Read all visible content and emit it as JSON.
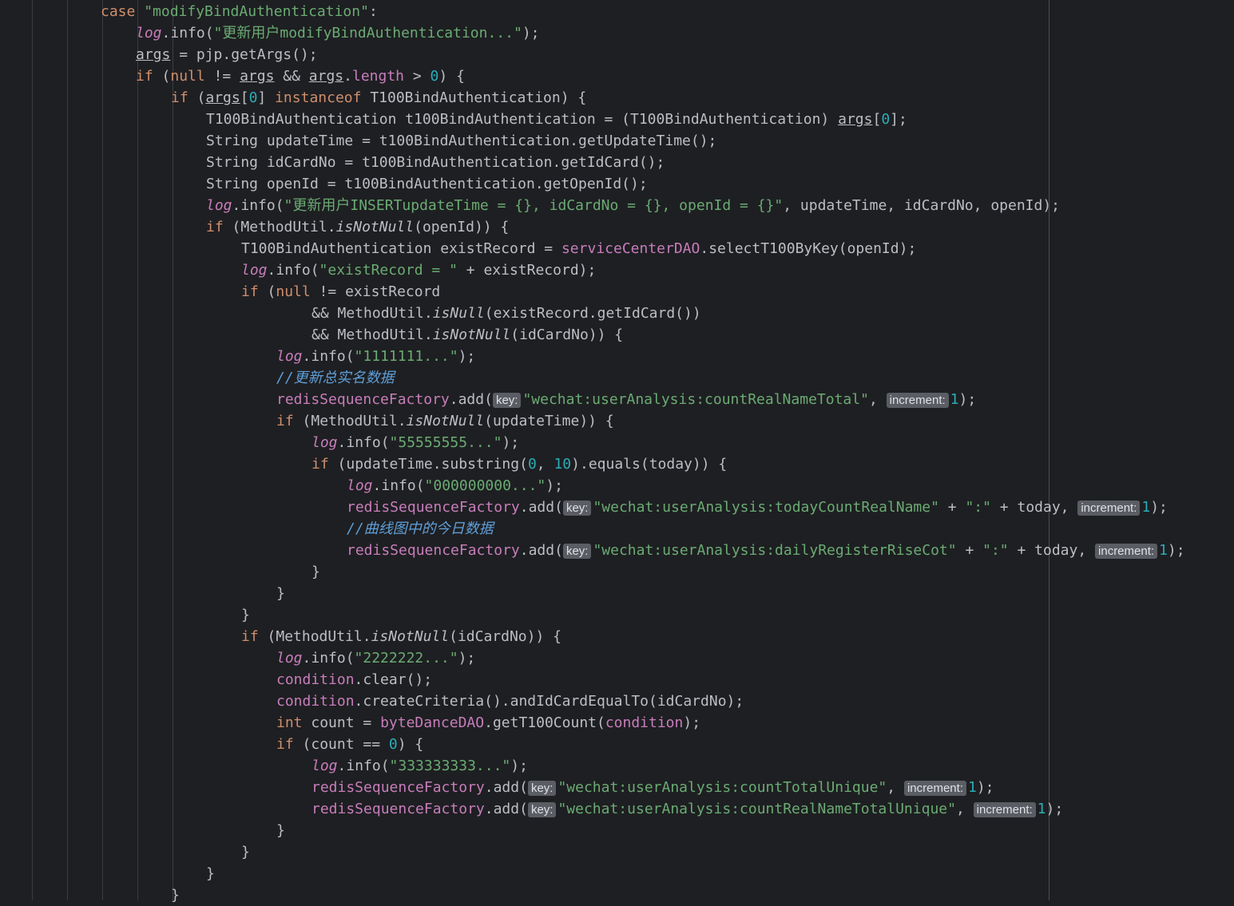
{
  "editor": {
    "lines": [
      {
        "indent": 126,
        "tokens": [
          {
            "t": "case ",
            "c": "kw"
          },
          {
            "t": "\"modifyBindAuthentication\"",
            "c": "str"
          },
          {
            "t": ":",
            "c": ""
          }
        ]
      },
      {
        "indent": 170,
        "tokens": [
          {
            "t": "log",
            "c": "log"
          },
          {
            "t": ".info(",
            "c": ""
          },
          {
            "t": "\"更新用户modifyBindAuthentication...\"",
            "c": "str"
          },
          {
            "t": ");",
            "c": ""
          }
        ]
      },
      {
        "indent": 170,
        "tokens": [
          {
            "t": "args",
            "c": "und"
          },
          {
            "t": " = pjp.getArgs();",
            "c": ""
          }
        ]
      },
      {
        "indent": 170,
        "tokens": [
          {
            "t": "if ",
            "c": "kw"
          },
          {
            "t": "(",
            "c": ""
          },
          {
            "t": "null",
            "c": "kw"
          },
          {
            "t": " != ",
            "c": ""
          },
          {
            "t": "args",
            "c": "und"
          },
          {
            "t": " && ",
            "c": ""
          },
          {
            "t": "args",
            "c": "und"
          },
          {
            "t": ".",
            "c": ""
          },
          {
            "t": "length",
            "c": "fld"
          },
          {
            "t": " > ",
            "c": ""
          },
          {
            "t": "0",
            "c": "num"
          },
          {
            "t": ") {",
            "c": ""
          }
        ]
      },
      {
        "indent": 214,
        "tokens": [
          {
            "t": "if ",
            "c": "kw"
          },
          {
            "t": "(",
            "c": ""
          },
          {
            "t": "args",
            "c": "und"
          },
          {
            "t": "[",
            "c": ""
          },
          {
            "t": "0",
            "c": "num"
          },
          {
            "t": "] ",
            "c": ""
          },
          {
            "t": "instanceof ",
            "c": "kw"
          },
          {
            "t": "T100BindAuthentication) {",
            "c": ""
          }
        ]
      },
      {
        "indent": 258,
        "tokens": [
          {
            "t": "T100BindAuthentication t100BindAuthentication = (T100BindAuthentication) ",
            "c": ""
          },
          {
            "t": "args",
            "c": "und"
          },
          {
            "t": "[",
            "c": ""
          },
          {
            "t": "0",
            "c": "num"
          },
          {
            "t": "];",
            "c": ""
          }
        ]
      },
      {
        "indent": 258,
        "tokens": [
          {
            "t": "String updateTime = t100BindAuthentication.getUpdateTime();",
            "c": ""
          }
        ]
      },
      {
        "indent": 258,
        "tokens": [
          {
            "t": "String idCardNo = t100BindAuthentication.getIdCard();",
            "c": ""
          }
        ]
      },
      {
        "indent": 258,
        "tokens": [
          {
            "t": "String openId = t100BindAuthentication.getOpenId();",
            "c": ""
          }
        ]
      },
      {
        "indent": 258,
        "tokens": [
          {
            "t": "log",
            "c": "log"
          },
          {
            "t": ".info(",
            "c": ""
          },
          {
            "t": "\"更新用户INSERTupdateTime = {}, idCardNo = {}, openId = {}\"",
            "c": "str"
          },
          {
            "t": ", updateTime, idCardNo, openId);",
            "c": ""
          }
        ]
      },
      {
        "indent": 258,
        "tokens": [
          {
            "t": "if ",
            "c": "kw"
          },
          {
            "t": "(MethodUtil.",
            "c": ""
          },
          {
            "t": "isNotNull",
            "c": "st"
          },
          {
            "t": "(openId)) {",
            "c": ""
          }
        ]
      },
      {
        "indent": 302,
        "tokens": [
          {
            "t": "T100BindAuthentication existRecord = ",
            "c": ""
          },
          {
            "t": "serviceCenterDAO",
            "c": "fld"
          },
          {
            "t": ".selectT100ByKey(openId);",
            "c": ""
          }
        ]
      },
      {
        "indent": 302,
        "tokens": [
          {
            "t": "log",
            "c": "log"
          },
          {
            "t": ".info(",
            "c": ""
          },
          {
            "t": "\"existRecord = \"",
            "c": "str"
          },
          {
            "t": " + existRecord);",
            "c": ""
          }
        ]
      },
      {
        "indent": 302,
        "tokens": [
          {
            "t": "if ",
            "c": "kw"
          },
          {
            "t": "(",
            "c": ""
          },
          {
            "t": "null",
            "c": "kw"
          },
          {
            "t": " != existRecord",
            "c": ""
          }
        ]
      },
      {
        "indent": 390,
        "tokens": [
          {
            "t": "&& MethodUtil.",
            "c": ""
          },
          {
            "t": "isNull",
            "c": "st"
          },
          {
            "t": "(existRecord.getIdCard())",
            "c": ""
          }
        ]
      },
      {
        "indent": 390,
        "tokens": [
          {
            "t": "&& MethodUtil.",
            "c": ""
          },
          {
            "t": "isNotNull",
            "c": "st"
          },
          {
            "t": "(idCardNo)) {",
            "c": ""
          }
        ]
      },
      {
        "indent": 346,
        "tokens": [
          {
            "t": "log",
            "c": "log"
          },
          {
            "t": ".info(",
            "c": ""
          },
          {
            "t": "\"1111111...\"",
            "c": "str"
          },
          {
            "t": ");",
            "c": ""
          }
        ]
      },
      {
        "indent": 346,
        "tokens": [
          {
            "t": "//更新总实名数据",
            "c": "cmt-cjk"
          }
        ]
      },
      {
        "indent": 346,
        "tokens": [
          {
            "t": "redisSequenceFactory",
            "c": "fld"
          },
          {
            "t": ".add(",
            "c": ""
          },
          {
            "hint": "key:"
          },
          {
            "t": "\"wechat:userAnalysis:countRealNameTotal\"",
            "c": "str"
          },
          {
            "t": ", ",
            "c": ""
          },
          {
            "hint": "increment:"
          },
          {
            "t": "1",
            "c": "num"
          },
          {
            "t": ");",
            "c": ""
          }
        ]
      },
      {
        "indent": 346,
        "tokens": [
          {
            "t": "if ",
            "c": "kw"
          },
          {
            "t": "(MethodUtil.",
            "c": ""
          },
          {
            "t": "isNotNull",
            "c": "st"
          },
          {
            "t": "(updateTime)) {",
            "c": ""
          }
        ]
      },
      {
        "indent": 390,
        "tokens": [
          {
            "t": "log",
            "c": "log"
          },
          {
            "t": ".info(",
            "c": ""
          },
          {
            "t": "\"55555555...\"",
            "c": "str"
          },
          {
            "t": ");",
            "c": ""
          }
        ]
      },
      {
        "indent": 390,
        "tokens": [
          {
            "t": "if ",
            "c": "kw"
          },
          {
            "t": "(updateTime.substring(",
            "c": ""
          },
          {
            "t": "0",
            "c": "num"
          },
          {
            "t": ", ",
            "c": ""
          },
          {
            "t": "10",
            "c": "num"
          },
          {
            "t": ").equals(today)) {",
            "c": ""
          }
        ]
      },
      {
        "indent": 434,
        "tokens": [
          {
            "t": "log",
            "c": "log"
          },
          {
            "t": ".info(",
            "c": ""
          },
          {
            "t": "\"000000000...\"",
            "c": "str"
          },
          {
            "t": ");",
            "c": ""
          }
        ]
      },
      {
        "indent": 434,
        "tokens": [
          {
            "t": "redisSequenceFactory",
            "c": "fld"
          },
          {
            "t": ".add(",
            "c": ""
          },
          {
            "hint": "key:"
          },
          {
            "t": "\"wechat:userAnalysis:todayCountRealName\"",
            "c": "str"
          },
          {
            "t": " + ",
            "c": ""
          },
          {
            "t": "\":\"",
            "c": "str"
          },
          {
            "t": " + today, ",
            "c": ""
          },
          {
            "hint": "increment:"
          },
          {
            "t": "1",
            "c": "num"
          },
          {
            "t": ");",
            "c": ""
          }
        ]
      },
      {
        "indent": 434,
        "tokens": [
          {
            "t": "//曲线图中的今日数据",
            "c": "cmt-cjk"
          }
        ]
      },
      {
        "indent": 434,
        "tokens": [
          {
            "t": "redisSequenceFactory",
            "c": "fld"
          },
          {
            "t": ".add(",
            "c": ""
          },
          {
            "hint": "key:"
          },
          {
            "t": "\"wechat:userAnalysis:dailyRegisterRiseCot\"",
            "c": "str"
          },
          {
            "t": " + ",
            "c": ""
          },
          {
            "t": "\":\"",
            "c": "str"
          },
          {
            "t": " + today, ",
            "c": ""
          },
          {
            "hint": "increment:"
          },
          {
            "t": "1",
            "c": "num"
          },
          {
            "t": ");",
            "c": ""
          }
        ]
      },
      {
        "indent": 390,
        "tokens": [
          {
            "t": "}",
            "c": ""
          }
        ]
      },
      {
        "indent": 346,
        "tokens": [
          {
            "t": "}",
            "c": ""
          }
        ]
      },
      {
        "indent": 302,
        "tokens": [
          {
            "t": "}",
            "c": ""
          }
        ]
      },
      {
        "indent": 302,
        "tokens": [
          {
            "t": "if ",
            "c": "kw"
          },
          {
            "t": "(MethodUtil.",
            "c": ""
          },
          {
            "t": "isNotNull",
            "c": "st"
          },
          {
            "t": "(idCardNo)) {",
            "c": ""
          }
        ]
      },
      {
        "indent": 346,
        "tokens": [
          {
            "t": "log",
            "c": "log"
          },
          {
            "t": ".info(",
            "c": ""
          },
          {
            "t": "\"2222222...\"",
            "c": "str"
          },
          {
            "t": ");",
            "c": ""
          }
        ]
      },
      {
        "indent": 346,
        "tokens": [
          {
            "t": "condition",
            "c": "fld"
          },
          {
            "t": ".clear();",
            "c": ""
          }
        ]
      },
      {
        "indent": 346,
        "tokens": [
          {
            "t": "condition",
            "c": "fld"
          },
          {
            "t": ".createCriteria().andIdCardEqualTo(idCardNo);",
            "c": ""
          }
        ]
      },
      {
        "indent": 346,
        "tokens": [
          {
            "t": "int ",
            "c": "kw"
          },
          {
            "t": "count = ",
            "c": ""
          },
          {
            "t": "byteDanceDAO",
            "c": "fld"
          },
          {
            "t": ".getT100Count(",
            "c": ""
          },
          {
            "t": "condition",
            "c": "fld"
          },
          {
            "t": ");",
            "c": ""
          }
        ]
      },
      {
        "indent": 346,
        "tokens": [
          {
            "t": "if ",
            "c": "kw"
          },
          {
            "t": "(count == ",
            "c": ""
          },
          {
            "t": "0",
            "c": "num"
          },
          {
            "t": ") {",
            "c": ""
          }
        ]
      },
      {
        "indent": 390,
        "tokens": [
          {
            "t": "log",
            "c": "log"
          },
          {
            "t": ".info(",
            "c": ""
          },
          {
            "t": "\"333333333...\"",
            "c": "str"
          },
          {
            "t": ");",
            "c": ""
          }
        ]
      },
      {
        "indent": 390,
        "tokens": [
          {
            "t": "redisSequenceFactory",
            "c": "fld"
          },
          {
            "t": ".add(",
            "c": ""
          },
          {
            "hint": "key:"
          },
          {
            "t": "\"wechat:userAnalysis:countTotalUnique\"",
            "c": "str"
          },
          {
            "t": ", ",
            "c": ""
          },
          {
            "hint": "increment:"
          },
          {
            "t": "1",
            "c": "num"
          },
          {
            "t": ");",
            "c": ""
          }
        ]
      },
      {
        "indent": 390,
        "tokens": [
          {
            "t": "redisSequenceFactory",
            "c": "fld"
          },
          {
            "t": ".add(",
            "c": ""
          },
          {
            "hint": "key:"
          },
          {
            "t": "\"wechat:userAnalysis:countRealNameTotalUnique\"",
            "c": "str"
          },
          {
            "t": ", ",
            "c": ""
          },
          {
            "hint": "increment:"
          },
          {
            "t": "1",
            "c": "num"
          },
          {
            "t": ");",
            "c": ""
          }
        ]
      },
      {
        "indent": 346,
        "tokens": [
          {
            "t": "}",
            "c": ""
          }
        ]
      },
      {
        "indent": 302,
        "tokens": [
          {
            "t": "}",
            "c": ""
          }
        ]
      },
      {
        "indent": 258,
        "tokens": [
          {
            "t": "}",
            "c": ""
          }
        ]
      },
      {
        "indent": 214,
        "tokens": [
          {
            "t": "}",
            "c": ""
          }
        ]
      }
    ]
  }
}
